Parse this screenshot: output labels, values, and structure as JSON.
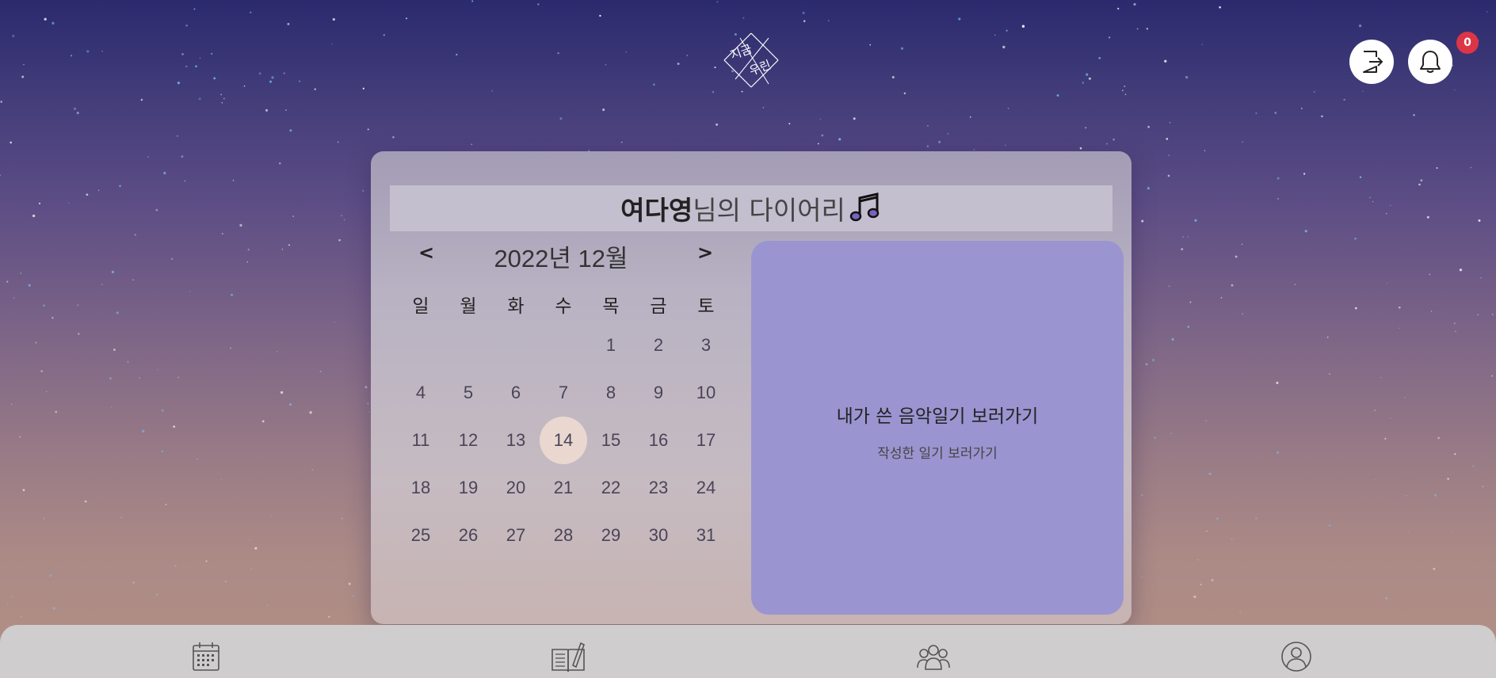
{
  "header": {
    "logo_text": [
      "지금",
      "우린"
    ],
    "notification_count": "0"
  },
  "diary": {
    "user_name": "여다영",
    "title_suffix": "님의 다이어리"
  },
  "calendar": {
    "prev_label": "<",
    "next_label": ">",
    "month_label": "2022년 12월",
    "weekdays": [
      "일",
      "월",
      "화",
      "수",
      "목",
      "금",
      "토"
    ],
    "days": [
      "",
      "",
      "",
      "",
      "1",
      "2",
      "3",
      "4",
      "5",
      "6",
      "7",
      "8",
      "9",
      "10",
      "11",
      "12",
      "13",
      "14",
      "15",
      "16",
      "17",
      "18",
      "19",
      "20",
      "21",
      "22",
      "23",
      "24",
      "25",
      "26",
      "27",
      "28",
      "29",
      "30",
      "31"
    ],
    "today": "14"
  },
  "music_panel": {
    "title": "내가 쓴 음악일기 보러가기",
    "subtitle": "작성한 일기 보러가기"
  },
  "bottom_nav": {
    "items": [
      "calendar-icon",
      "diary-write-icon",
      "friends-icon",
      "profile-icon"
    ]
  },
  "colors": {
    "panel": "#9a95d0",
    "today_highlight": "#ead8d0",
    "badge": "#dc3545",
    "music_note": "#7a62c2"
  }
}
